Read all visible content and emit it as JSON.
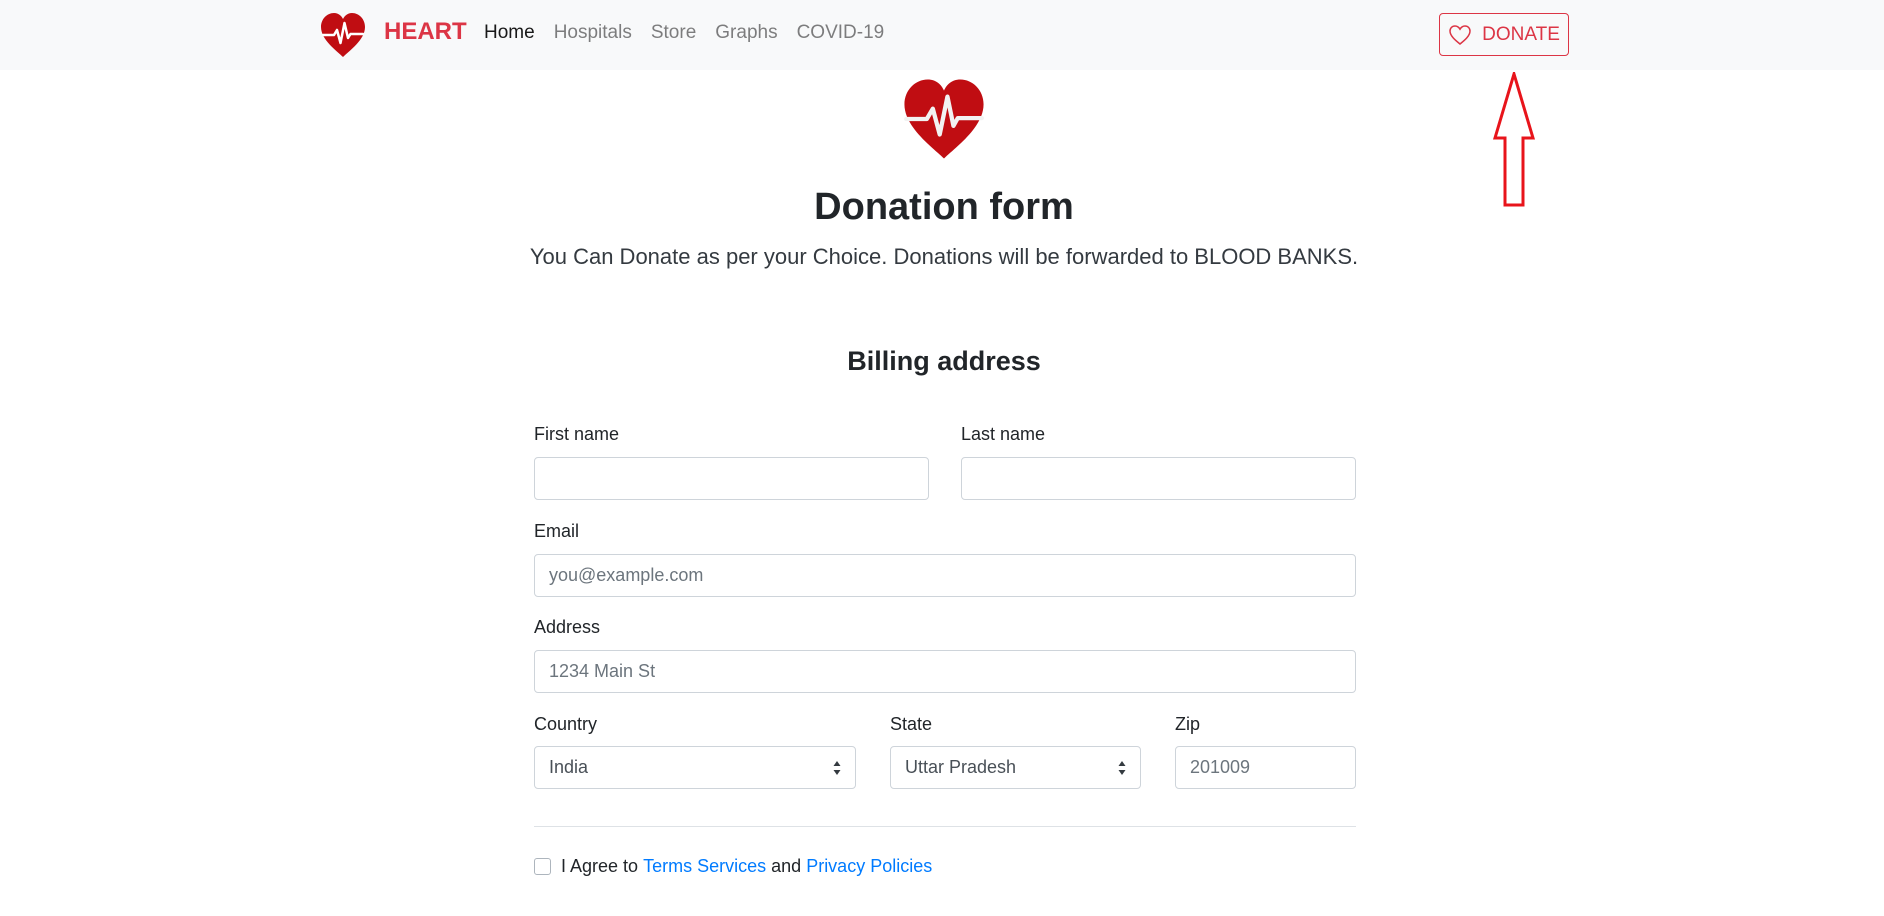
{
  "navbar": {
    "brand": "HEART",
    "links": [
      {
        "label": "Home"
      },
      {
        "label": "Hospitals"
      },
      {
        "label": "Store"
      },
      {
        "label": "Graphs"
      },
      {
        "label": "COVID-19"
      }
    ],
    "donate_label": "DONATE"
  },
  "hero": {
    "title": "Donation form",
    "lead": "You Can Donate as per your Choice. Donations will be forwarded to BLOOD BANKS."
  },
  "form": {
    "section_title": "Billing address",
    "first_name": {
      "label": "First name",
      "value": ""
    },
    "last_name": {
      "label": "Last name",
      "value": ""
    },
    "email": {
      "label": "Email",
      "placeholder": "you@example.com"
    },
    "address": {
      "label": "Address",
      "placeholder": "1234 Main St"
    },
    "country": {
      "label": "Country",
      "selected": "India"
    },
    "state": {
      "label": "State",
      "selected": "Uttar Pradesh"
    },
    "zip": {
      "label": "Zip",
      "placeholder": "201009"
    },
    "agree": {
      "prefix": "I Agree to",
      "terms": "Terms Services",
      "conjunction": "and",
      "privacy": "Privacy Policies"
    }
  },
  "colors": {
    "brand": "#dc3545",
    "heart": "#c00d12",
    "link": "#007bff",
    "annotation": "#e8141b"
  },
  "icons": {
    "brand_logo": "heart-pulse-icon",
    "donate": "heart-outline-icon",
    "select_caret": "sort-caret-icon",
    "annotation": "up-arrow-annotation"
  }
}
